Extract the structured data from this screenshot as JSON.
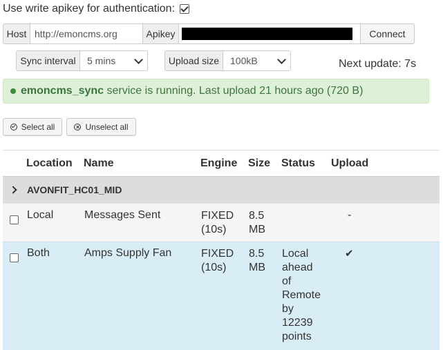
{
  "auth": {
    "label": "Use write apikey for authentication:",
    "checked": true
  },
  "connection": {
    "host_label": "Host",
    "host_value": "http://emoncms.org",
    "apikey_label": "Apikey",
    "apikey_masked": true,
    "connect_label": "Connect"
  },
  "sync": {
    "interval_label": "Sync interval",
    "interval_value": "5 mins",
    "upload_label": "Upload size",
    "upload_value": "100kB",
    "next_update": "Next update: 7s"
  },
  "status": {
    "service_name": "emoncms_sync",
    "message": " service is running. Last upload 21 hours ago (720 B)",
    "color": "#3c763d",
    "bg": "#dff0d8"
  },
  "actions": {
    "select_all": "Select all",
    "unselect_all": "Unselect all"
  },
  "table": {
    "headers": [
      "Location",
      "Name",
      "Engine",
      "Size",
      "Status",
      "Upload"
    ],
    "group": {
      "name": "AVONFIT_HC01_MID",
      "icon": "chevron-right-icon"
    },
    "rows": [
      {
        "location": "Local",
        "name": "Messages Sent",
        "engine_1": "FIXED",
        "engine_2": "(10s)",
        "size_1": "8.5",
        "size_2": "MB",
        "status_lines": [],
        "upload": "-"
      },
      {
        "location": "Both",
        "name": "Amps Supply Fan",
        "engine_1": "FIXED",
        "engine_2": "(10s)",
        "size_1": "8.5",
        "size_2": "MB",
        "status_lines": [
          "Local",
          "ahead",
          "of",
          "Remote",
          "by",
          "12239",
          "points"
        ],
        "upload": "✔"
      }
    ]
  }
}
